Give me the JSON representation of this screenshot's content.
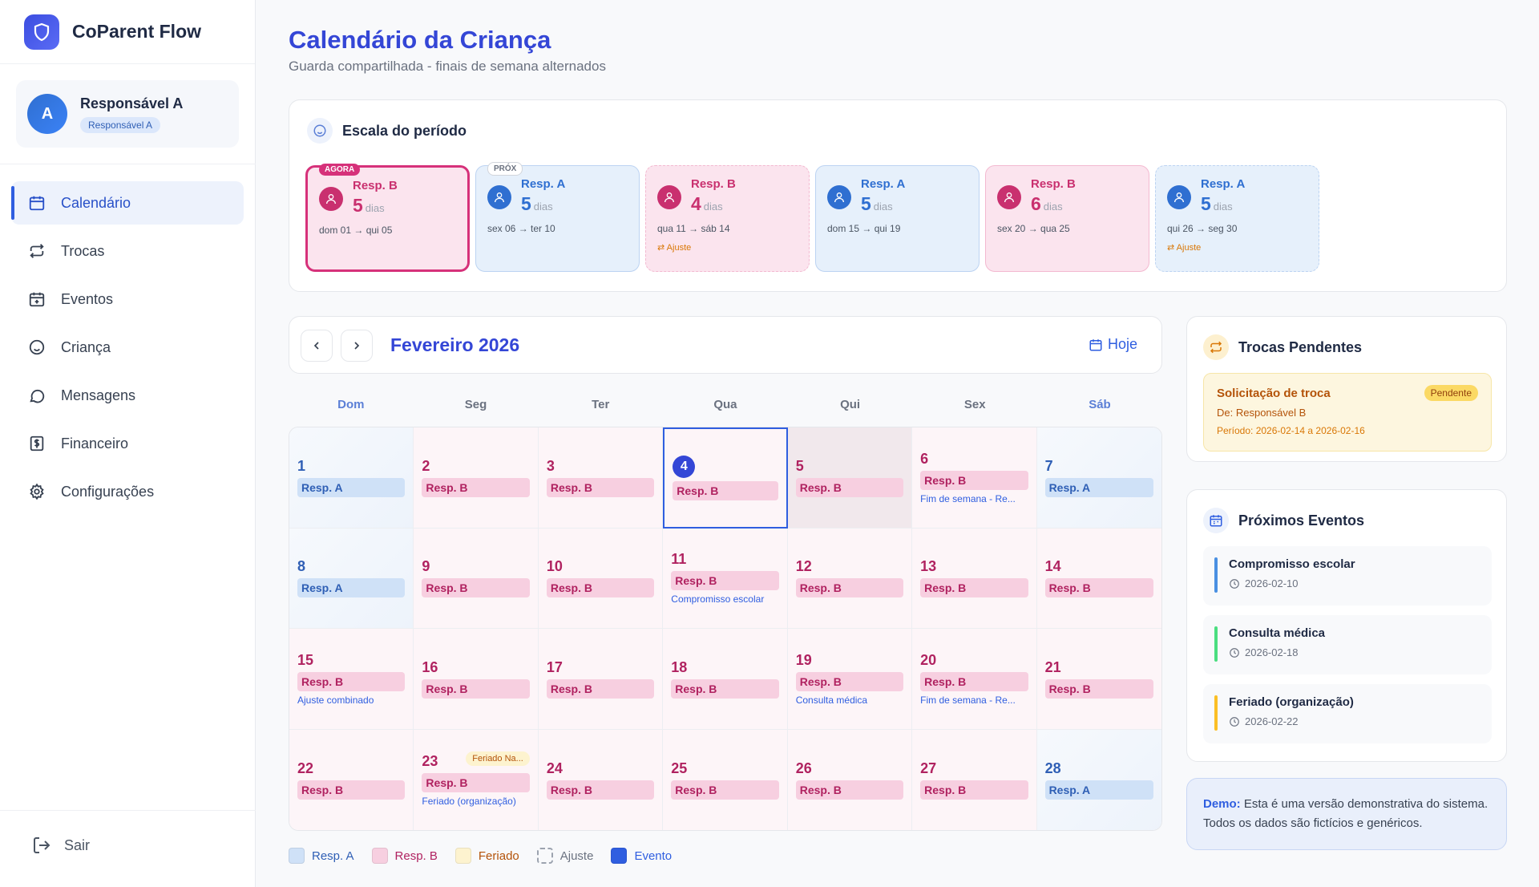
{
  "app": {
    "name": "CoParent Flow"
  },
  "user": {
    "avatar": "A",
    "name": "Responsável A",
    "role": "Responsável A"
  },
  "nav": [
    {
      "label": "Calendário",
      "icon": "calendar-icon",
      "active": true
    },
    {
      "label": "Trocas",
      "icon": "swap-icon",
      "active": false
    },
    {
      "label": "Eventos",
      "icon": "calendar-plus-icon",
      "active": false
    },
    {
      "label": "Criança",
      "icon": "smile-icon",
      "active": false
    },
    {
      "label": "Mensagens",
      "icon": "message-icon",
      "active": false
    },
    {
      "label": "Financeiro",
      "icon": "dollar-icon",
      "active": false
    },
    {
      "label": "Configurações",
      "icon": "gear-icon",
      "active": false
    }
  ],
  "logout": {
    "label": "Sair"
  },
  "header": {
    "title": "Calendário da Criança",
    "subtitle": "Guarda compartilhada - finais de semana alternados"
  },
  "period": {
    "title": "Escala do período",
    "cards": [
      {
        "who": "Resp. B",
        "days": "5",
        "unit": "dias",
        "range": "dom 01 → qui 05",
        "badge": "AGORA",
        "adjust": ""
      },
      {
        "who": "Resp. A",
        "days": "5",
        "unit": "dias",
        "range": "sex 06 → ter 10",
        "badge": "PRÓX",
        "adjust": ""
      },
      {
        "who": "Resp. B",
        "days": "4",
        "unit": "dias",
        "range": "qua 11 → sáb 14",
        "badge": "",
        "adjust": "Ajuste"
      },
      {
        "who": "Resp. A",
        "days": "5",
        "unit": "dias",
        "range": "dom 15 → qui 19",
        "badge": "",
        "adjust": ""
      },
      {
        "who": "Resp. B",
        "days": "6",
        "unit": "dias",
        "range": "sex 20 → qua 25",
        "badge": "",
        "adjust": ""
      },
      {
        "who": "Resp. A",
        "days": "5",
        "unit": "dias",
        "range": "qui 26 → seg 30",
        "badge": "",
        "adjust": "Ajuste"
      }
    ]
  },
  "calendar": {
    "month": "Fevereiro 2026",
    "today_label": "Hoje",
    "weekdays": [
      "Dom",
      "Seg",
      "Ter",
      "Qua",
      "Qui",
      "Sex",
      "Sáb"
    ],
    "days": [
      {
        "n": "1",
        "who": "Resp. A",
        "event": ""
      },
      {
        "n": "2",
        "who": "Resp. B",
        "event": ""
      },
      {
        "n": "3",
        "who": "Resp. B",
        "event": ""
      },
      {
        "n": "4",
        "who": "Resp. B",
        "event": ""
      },
      {
        "n": "5",
        "who": "Resp. B",
        "event": ""
      },
      {
        "n": "6",
        "who": "Resp. B",
        "event": "Fim de semana - Re..."
      },
      {
        "n": "7",
        "who": "Resp. A",
        "event": ""
      },
      {
        "n": "8",
        "who": "Resp. A",
        "event": ""
      },
      {
        "n": "9",
        "who": "Resp. B",
        "event": ""
      },
      {
        "n": "10",
        "who": "Resp. B",
        "event": ""
      },
      {
        "n": "11",
        "who": "Resp. B",
        "event": "Compromisso escolar"
      },
      {
        "n": "12",
        "who": "Resp. B",
        "event": ""
      },
      {
        "n": "13",
        "who": "Resp. B",
        "event": ""
      },
      {
        "n": "14",
        "who": "Resp. B",
        "event": ""
      },
      {
        "n": "15",
        "who": "Resp. B",
        "event": "Ajuste combinado"
      },
      {
        "n": "16",
        "who": "Resp. B",
        "event": ""
      },
      {
        "n": "17",
        "who": "Resp. B",
        "event": ""
      },
      {
        "n": "18",
        "who": "Resp. B",
        "event": ""
      },
      {
        "n": "19",
        "who": "Resp. B",
        "event": "Consulta médica"
      },
      {
        "n": "20",
        "who": "Resp. B",
        "event": "Fim de semana - Re..."
      },
      {
        "n": "21",
        "who": "Resp. B",
        "event": ""
      },
      {
        "n": "22",
        "who": "Resp. B",
        "event": ""
      },
      {
        "n": "23",
        "who": "Resp. B",
        "event": "Feriado (organização)",
        "tag": "Feriado Na..."
      },
      {
        "n": "24",
        "who": "Resp. B",
        "event": ""
      },
      {
        "n": "25",
        "who": "Resp. B",
        "event": ""
      },
      {
        "n": "26",
        "who": "Resp. B",
        "event": ""
      },
      {
        "n": "27",
        "who": "Resp. B",
        "event": ""
      },
      {
        "n": "28",
        "who": "Resp. A",
        "event": ""
      }
    ]
  },
  "legend": [
    {
      "label": "Resp. A",
      "color": "#cfe1f7",
      "text": "#2f5fb5"
    },
    {
      "label": "Resp. B",
      "color": "#f7cfe0",
      "text": "#b02260"
    },
    {
      "label": "Feriado",
      "color": "#fdf3cf",
      "text": "#b45309"
    },
    {
      "label": "Ajuste",
      "color": "transparent",
      "text": "#6b7280"
    },
    {
      "label": "Evento",
      "color": "#2f5ee0",
      "text": "#2f5ee0"
    }
  ],
  "trocas": {
    "title": "Trocas Pendentes",
    "request": {
      "title": "Solicitação de troca",
      "badge": "Pendente",
      "from": "De: Responsável B",
      "period": "Período: 2026-02-14 a 2026-02-16"
    }
  },
  "eventos": {
    "title": "Próximos Eventos",
    "items": [
      {
        "title": "Compromisso escolar",
        "date": "2026-02-10",
        "color": "#4a90e2"
      },
      {
        "title": "Consulta médica",
        "date": "2026-02-18",
        "color": "#4ade80"
      },
      {
        "title": "Feriado (organização)",
        "date": "2026-02-22",
        "color": "#fbbf24"
      }
    ]
  },
  "demo": {
    "label": "Demo:",
    "text": " Esta é uma versão demonstrativa do sistema. Todos os dados são fictícios e genéricos."
  }
}
